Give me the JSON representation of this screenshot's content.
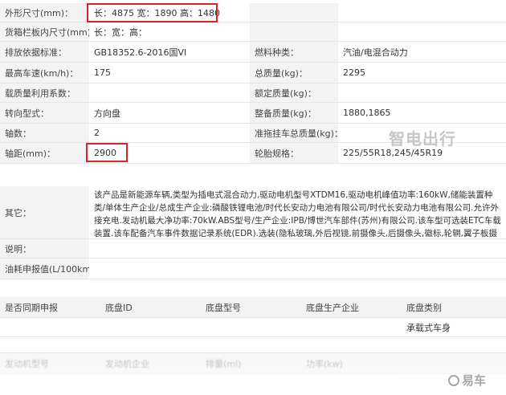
{
  "spec_rows": [
    {
      "l1": "外形尺寸(mm)：",
      "v1": "长：4875 宽：1890 高：1480",
      "l2": "",
      "v2": ""
    },
    {
      "l1": "货箱栏板内尺寸(mm)：",
      "v1": "长：宽：高：",
      "l2": "",
      "v2": ""
    },
    {
      "l1": "排放依据标准：",
      "v1": "GB18352.6-2016国VI",
      "l2": "燃料种类：",
      "v2": "汽油/电混合动力"
    },
    {
      "l1": "最高车速(km/h)：",
      "v1": "175",
      "l2": "总质量(kg)：",
      "v2": "2295"
    },
    {
      "l1": "载质量利用系数：",
      "v1": "",
      "l2": "额定质量(kg)：",
      "v2": ""
    },
    {
      "l1": "转向型式：",
      "v1": "方向盘",
      "l2": "整备质量(kg)：",
      "v2": "1880,1865"
    },
    {
      "l1": "轴数：",
      "v1": "2",
      "l2": "准拖挂车总质量(kg)：",
      "v2": ""
    },
    {
      "l1": "轴距(mm)：",
      "v1": "2900",
      "l2": "轮胎规格：",
      "v2": "225/55R18,245/45R19"
    }
  ],
  "watermark_top": "智电出行",
  "other": {
    "label": "其它：",
    "text": "该产品是新能源车辆,类型为插电式混合动力,驱动电机型号XTDM16,驱动电机峰值功率:160kW,储能装置种类/单体生产企业/总成生产企业:磷酸铁锂电池/时代长安动力电池有限公司/时代长安动力电池有限公司.允许外接充电.发动机最大净功率:70kW.ABS型号/生产企业:IPB/博世汽车部件(苏州)有限公司.该车型可选装ETC车载装置.该车配备汽车事件数据记录系统(EDR).选装(隐私玻璃,外后视镜,前摄像头,后摄像头,徽标,轮辋,翼子板摄像头,无翼子板摄像头,电动尾翼)."
  },
  "note_label": "说明：",
  "fuel_label": "油耗申报值(L/100km)：",
  "chassis_headers": [
    "是否同期申报",
    "底盘ID",
    "底盘型号",
    "底盘生产企业",
    "底盘类别"
  ],
  "chassis_values": [
    "",
    "",
    "",
    "",
    "承载式车身"
  ],
  "engine_headers": [
    "发动机型号",
    "发动机企业",
    "排量(ml)",
    "功率(kw)",
    ""
  ],
  "watermark_bottom": "易车"
}
